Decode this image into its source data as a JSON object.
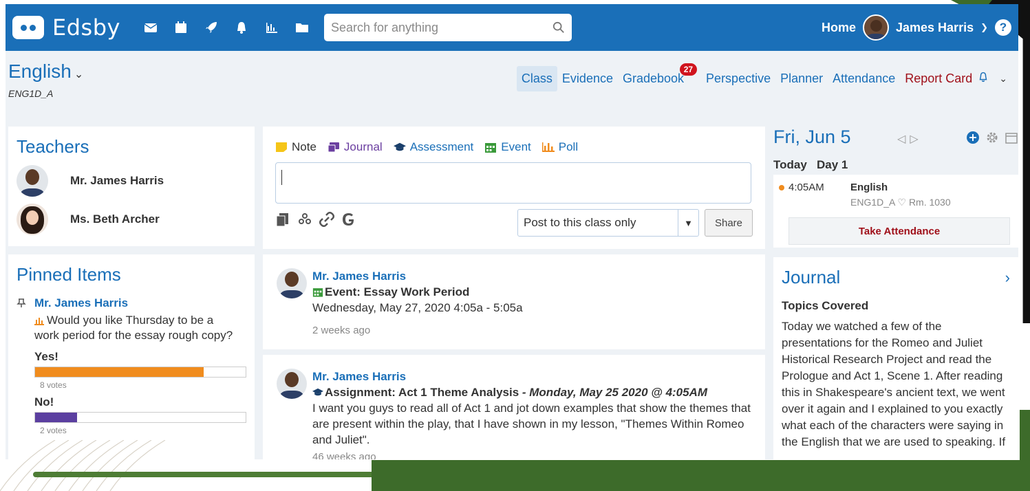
{
  "app": {
    "logo": "Edsby",
    "search_placeholder": "Search for anything",
    "home_label": "Home",
    "user_name": "James Harris",
    "help_label": "?"
  },
  "class": {
    "name": "English",
    "code": "ENG1D_A",
    "tabs": [
      {
        "label": "Class"
      },
      {
        "label": "Evidence"
      },
      {
        "label": "Gradebook",
        "badge": "27"
      },
      {
        "label": "Perspective"
      },
      {
        "label": "Planner"
      },
      {
        "label": "Attendance"
      },
      {
        "label": "Report Card"
      }
    ]
  },
  "teachers": {
    "title": "Teachers",
    "list": [
      {
        "name": "Mr. James Harris"
      },
      {
        "name": "Ms. Beth Archer"
      }
    ]
  },
  "pinned": {
    "title": "Pinned Items",
    "author": "Mr. James Harris",
    "question": "Would you like Thursday to be a work period for the essay rough copy?",
    "options": [
      {
        "label": "Yes!",
        "votes": "8 votes",
        "fraction": 0.8,
        "color": "#f08c1e"
      },
      {
        "label": "No!",
        "votes": "2 votes",
        "fraction": 0.2,
        "color": "#5b3fa0"
      }
    ]
  },
  "composer": {
    "types": [
      {
        "label": "Note",
        "color": "#333333"
      },
      {
        "label": "Journal",
        "color": "#6b3fa0"
      },
      {
        "label": "Assessment",
        "color": "#1a6fb8"
      },
      {
        "label": "Event",
        "color": "#1a6fb8"
      },
      {
        "label": "Poll",
        "color": "#1a6fb8"
      }
    ],
    "post_target": "Post to this class only",
    "share_label": "Share"
  },
  "feed": [
    {
      "author": "Mr. James Harris",
      "title": "Event: Essay Work Period",
      "detail": "Wednesday, May 27, 2020 4:05a - 5:05a",
      "ago": "2 weeks ago"
    },
    {
      "author": "Mr. James Harris",
      "title": "Assignment: Act 1 Theme Analysis",
      "date": " - Monday, May 25 2020 @ 4:05AM",
      "detail": "I want you guys to read all of Act 1 and jot down examples that show the themes that are present within the play, that I have shown in my lesson, \"Themes Within Romeo and Juliet\".",
      "ago": "46 weeks ago"
    }
  ],
  "calendar": {
    "date": "Fri, Jun 5",
    "today": "Today",
    "day": "Day 1",
    "entry": {
      "time": "4:05AM",
      "class": "English",
      "code": "ENG1D_A",
      "room": "Rm. 1030"
    },
    "take_attendance": "Take Attendance"
  },
  "journal": {
    "title": "Journal",
    "topics_label": "Topics Covered",
    "text": "Today we watched a few of the presentations for the Romeo and Juliet Historical Research Project and read the Prologue and Act 1, Scene 1. After reading this in Shakespeare's ancient text, we went over it again and I explained to you exactly what each of the characters were saying in the English that we are used to speaking. If"
  },
  "colors": {
    "brand_blue": "#1a6fb8",
    "report_red": "#a0101a",
    "badge_red": "#d0141e",
    "decor_green": "#3d6b2a"
  }
}
